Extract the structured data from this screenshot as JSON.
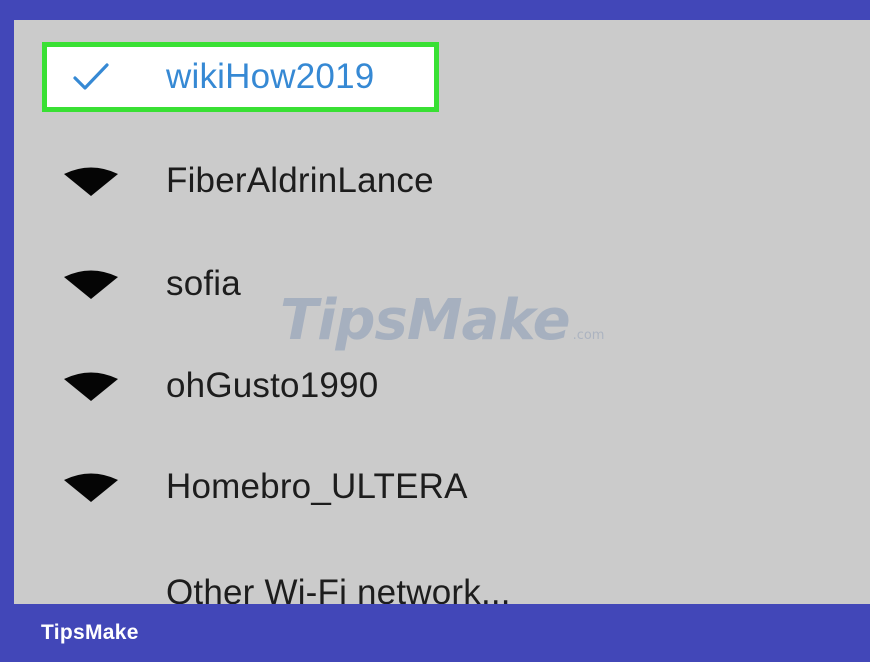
{
  "networks": {
    "selected": {
      "name": "wikiHow2019",
      "icon": "checkmark-icon"
    },
    "items": [
      {
        "name": "FiberAldrinLance",
        "icon": "wifi-signal-icon"
      },
      {
        "name": "sofia",
        "icon": "wifi-signal-icon"
      },
      {
        "name": "ohGusto1990",
        "icon": "wifi-signal-icon"
      },
      {
        "name": "Homebro_ULTERA",
        "icon": "wifi-signal-icon"
      }
    ],
    "other": "Other Wi-Fi network..."
  },
  "watermark": {
    "text": "TipsMake",
    "suffix": ".com"
  },
  "footer": {
    "brand": "TipsMake"
  },
  "colors": {
    "frame": "#4247b8",
    "panel": "#cbcbcb",
    "highlight_border": "#39e034",
    "selected_text": "#3689d4"
  }
}
